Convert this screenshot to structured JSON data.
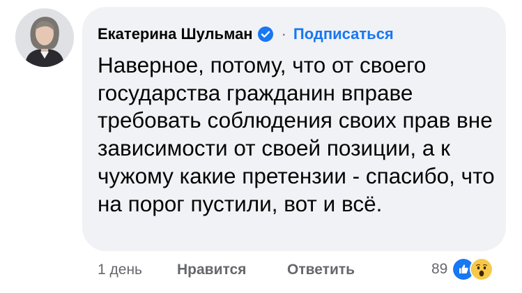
{
  "comment": {
    "author_name": "Екатерина Шульман",
    "separator": "·",
    "follow_label": "Подписаться",
    "text": "Наверное, потому, что от своего государства гражданин вправе требовать соблюдения своих прав вне зависимости от своей позиции, а к чужому какие претензии - спасибо, что на порог пустили, вот и всё."
  },
  "footer": {
    "time": "1 день",
    "like_label": "Нравится",
    "reply_label": "Ответить",
    "reaction_count": "89",
    "reactions": [
      "like-icon",
      "wow-icon"
    ]
  },
  "colors": {
    "bubble": "#f0f2f5",
    "link": "#1877f2",
    "secondary_text": "#65676b",
    "verified_badge": "#1877f2"
  }
}
